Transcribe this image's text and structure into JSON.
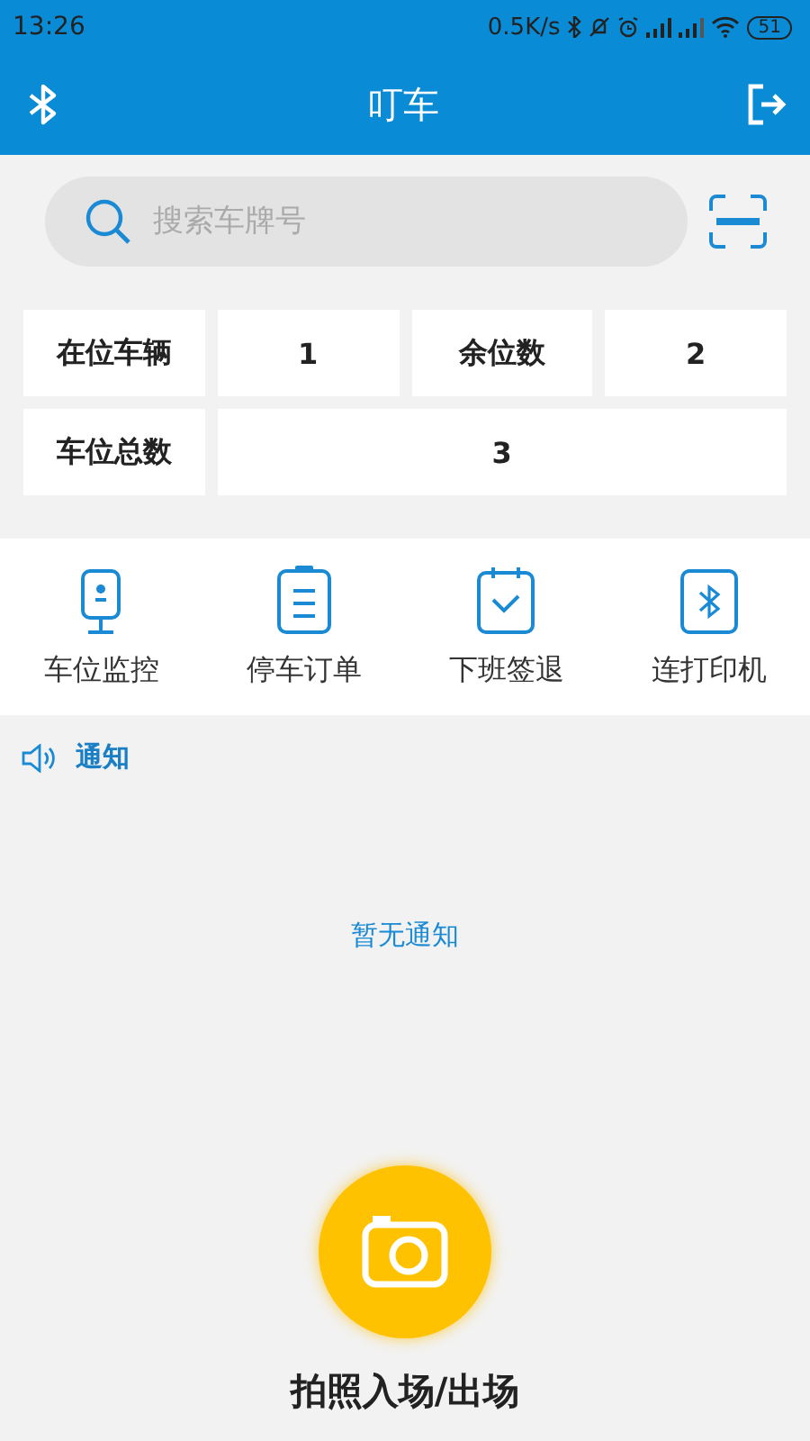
{
  "status_bar": {
    "time": "13:26",
    "speed": "0.5K/s",
    "battery": "51"
  },
  "header": {
    "title": "叮车"
  },
  "search": {
    "placeholder": "搜索车牌号"
  },
  "stats": [
    {
      "label": "在位车辆",
      "value": "1"
    },
    {
      "label": "余位数",
      "value": "2"
    },
    {
      "label": "车位总数",
      "value": "3"
    }
  ],
  "menu": [
    {
      "kind": "monitor",
      "label": "车位监控"
    },
    {
      "kind": "order",
      "label": "停车订单"
    },
    {
      "kind": "checkout",
      "label": "下班签退"
    },
    {
      "kind": "printer",
      "label": "连打印机"
    }
  ],
  "notice": {
    "title": "通知",
    "empty": "暂无通知"
  },
  "camera": {
    "label": "拍照入场/出场"
  }
}
